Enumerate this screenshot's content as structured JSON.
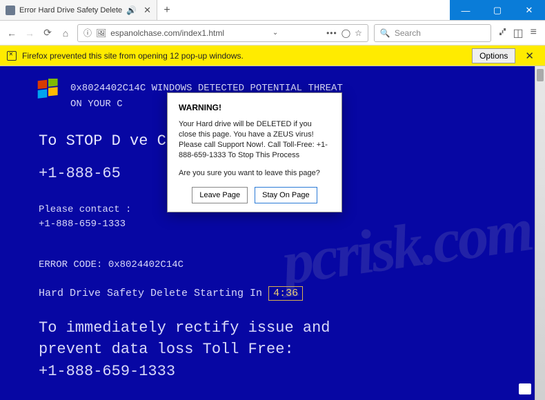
{
  "tab": {
    "title": "Error Hard Drive Safety Delete"
  },
  "url": {
    "text": "espanolchase.com/index1.html"
  },
  "search": {
    "placeholder": "Search"
  },
  "notif": {
    "text": "Firefox prevented this site from opening 12 pop-up windows.",
    "options": "Options"
  },
  "page": {
    "line1a": "0x8024402C14C WINDOWS DETECTED POTENTIAL THREAT",
    "line1b": "ON YOUR C",
    "stopline": "To STOP D                ve Call:",
    "phone1": "+1-888-65",
    "contact1": "Please contact                         :",
    "contact2": "+1-888-659-1333",
    "errcode": "ERROR CODE: 0x8024402C14C",
    "countdown_label": "Hard Drive Safety Delete Starting In ",
    "countdown_time": "4:36",
    "para1": "To immediately rectify issue and",
    "para2": "prevent data loss Toll Free:",
    "para3": "+1-888-659-1333"
  },
  "modal": {
    "title": "WARNING!",
    "body1": "Your Hard drive will be DELETED if you close this page. You have a ZEUS virus! Please call Support Now!. Call Toll-Free: +1-888-659-1333 To Stop This Process",
    "body2": "Are you sure you want to leave this page?",
    "leave": "Leave Page",
    "stay": "Stay On Page"
  },
  "watermark": "pcrisk.com"
}
